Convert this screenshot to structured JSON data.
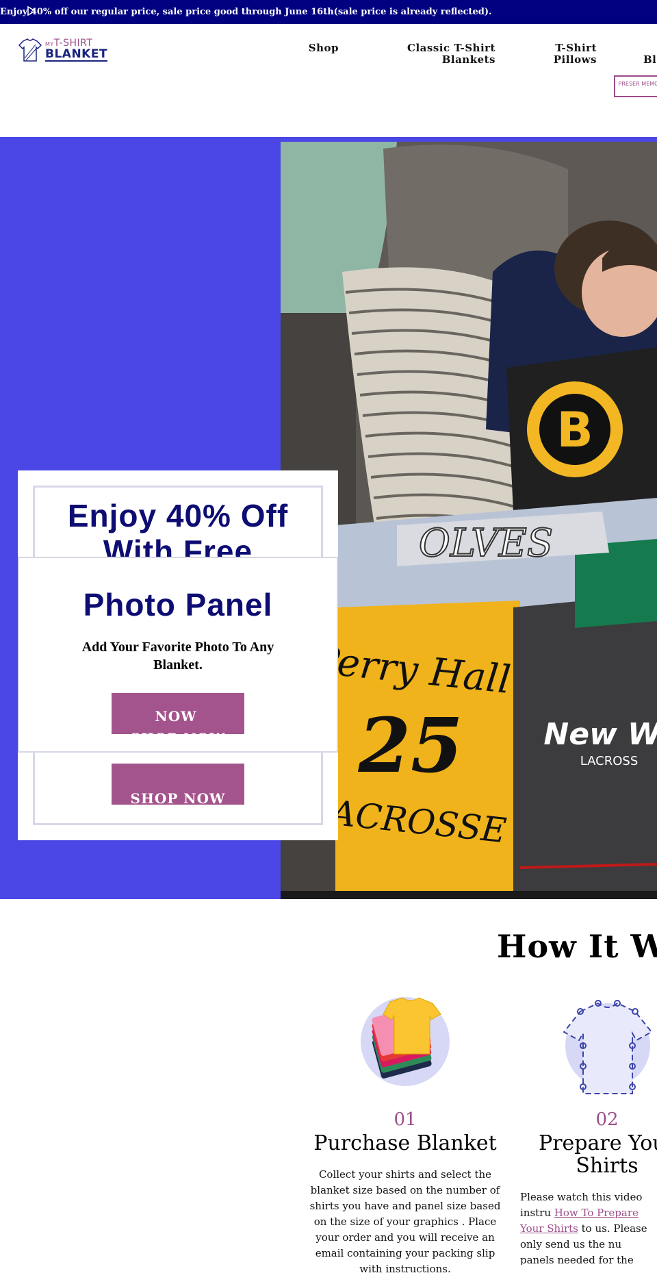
{
  "announcement": {
    "text": "Enjoy 40% off our regular price, sale price good through June 16th(sale price is already reflected)."
  },
  "logo": {
    "line1_small": "MY",
    "line1": "T-SHIRT",
    "line2": "BLANKET"
  },
  "nav": {
    "items": [
      {
        "label": "Shop"
      },
      {
        "label": "Classic T-Shirt Blankets"
      },
      {
        "label": "T-Shirt Pillows"
      },
      {
        "label": "Bl"
      }
    ],
    "preserve_button": "PRESER MEMO R"
  },
  "hero": {
    "card_back": {
      "heading": "Enjoy 40% Off With Free",
      "button_label": "SHOP NOW"
    },
    "card_front": {
      "heading": "Photo Panel",
      "subtext": "Add Your Favorite Photo To Any Blanket.",
      "button_label": "SHOP NOW"
    },
    "overflow_label": "NOW"
  },
  "how_it_works": {
    "title": "How It Wo",
    "steps": [
      {
        "number": "01",
        "title": "Purchase Blanket",
        "description": "Collect your shirts and select the blanket size based on the number of shirts you have and panel size based on the size of your graphics . Place your order and you will receive an email containing your packing slip with instructions."
      },
      {
        "number": "02",
        "title": "Prepare Your Shirts",
        "description_pre": "Please watch this video instru",
        "link": "How To Prepare Your Shirts",
        "description_post": " to us. Please only send us the nu panels needed for the blanket have chosen."
      }
    ]
  },
  "colors": {
    "announcement_bg": "#000080",
    "hero_bg": "#4a47e6",
    "accent": "#a3548c",
    "heading_navy": "#0d0d73"
  },
  "icons": [
    "play-icon",
    "shirt-logo-icon",
    "folded-shirts-icon",
    "shirt-pins-icon"
  ]
}
